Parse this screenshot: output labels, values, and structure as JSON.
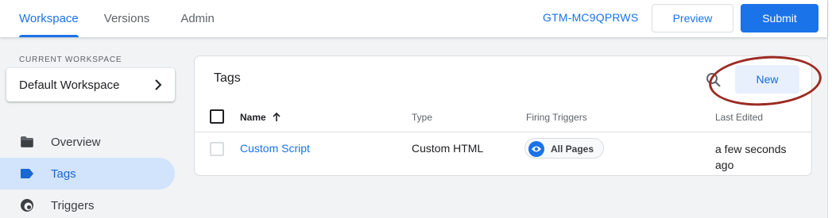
{
  "header": {
    "tabs": [
      {
        "label": "Workspace",
        "active": true
      },
      {
        "label": "Versions",
        "active": false
      },
      {
        "label": "Admin",
        "active": false
      }
    ],
    "container_id": "GTM-MC9QPRWS",
    "preview_label": "Preview",
    "submit_label": "Submit"
  },
  "sidebar": {
    "workspace_label": "CURRENT WORKSPACE",
    "workspace_name": "Default Workspace",
    "items": [
      {
        "label": "Overview",
        "icon": "folder-icon",
        "active": false
      },
      {
        "label": "Tags",
        "icon": "tag-icon",
        "active": true
      },
      {
        "label": "Triggers",
        "icon": "trigger-icon",
        "active": false
      }
    ]
  },
  "main": {
    "title": "Tags",
    "new_label": "New",
    "columns": {
      "name": "Name",
      "type": "Type",
      "triggers": "Firing Triggers",
      "edited": "Last Edited"
    },
    "rows": [
      {
        "name": "Custom Script",
        "type": "Custom HTML",
        "trigger": "All Pages",
        "edited": "a few seconds ago"
      }
    ]
  },
  "colors": {
    "accent": "#1a73e8",
    "active_nav_bg": "#d2e3fc",
    "highlight_ring": "#9c2b23"
  }
}
